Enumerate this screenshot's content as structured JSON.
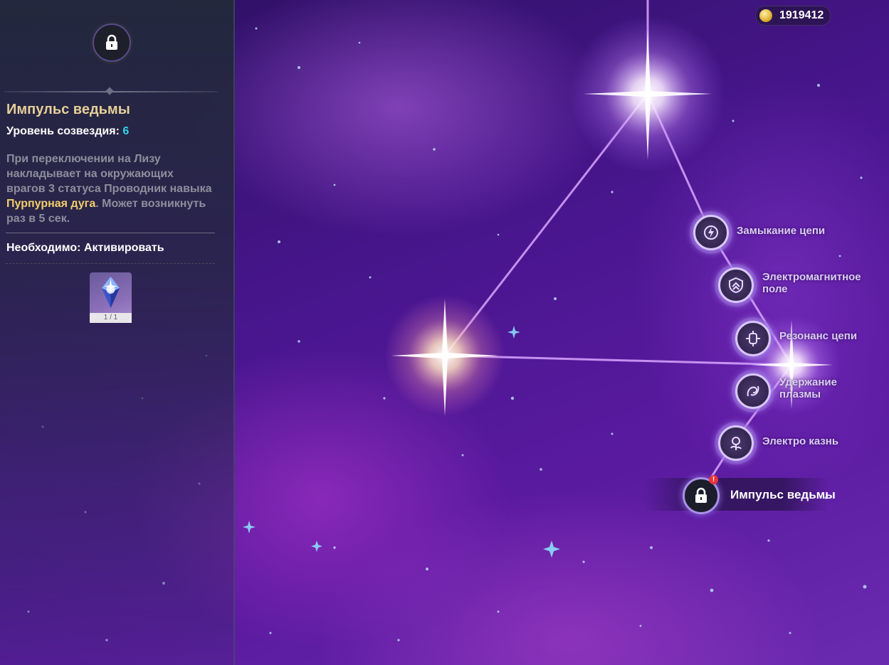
{
  "currency": {
    "icon": "mora-coin-icon",
    "amount": "1919412"
  },
  "panel": {
    "title": "Импульс ведьмы",
    "level_label": "Уровень созвездия:",
    "level_value": "6",
    "description_part1": "При переключении на Лизу накладывает на окружающих врагов 3 статуса Проводник навыка ",
    "description_highlight": "Пурпурная дуга",
    "description_part2": ". Может возникнуть раз в 5 сек.",
    "requirement": "Необходимо: Активировать",
    "item": {
      "icon": "constellation-material-icon",
      "count": "1 / 1"
    }
  },
  "constellations": [
    {
      "label": "Замыкание цепи",
      "icon": "electro-circuit-icon"
    },
    {
      "label": "Электромагнитное поле",
      "icon": "shield-chevron-icon"
    },
    {
      "label": "Резонанс цепи",
      "icon": "lantern-icon"
    },
    {
      "label": "Удержание плазмы",
      "icon": "plasma-swirl-icon"
    },
    {
      "label": "Электро казнь",
      "icon": "rose-icon"
    },
    {
      "label": "Импульс ведьмы",
      "icon": "lock-icon",
      "locked": true,
      "alert": "!"
    }
  ],
  "colors": {
    "accent_gold": "#e6cf98",
    "highlight": "#f3cd6a",
    "level_cyan": "#2fd3e8",
    "alert_red": "#e8333a"
  }
}
